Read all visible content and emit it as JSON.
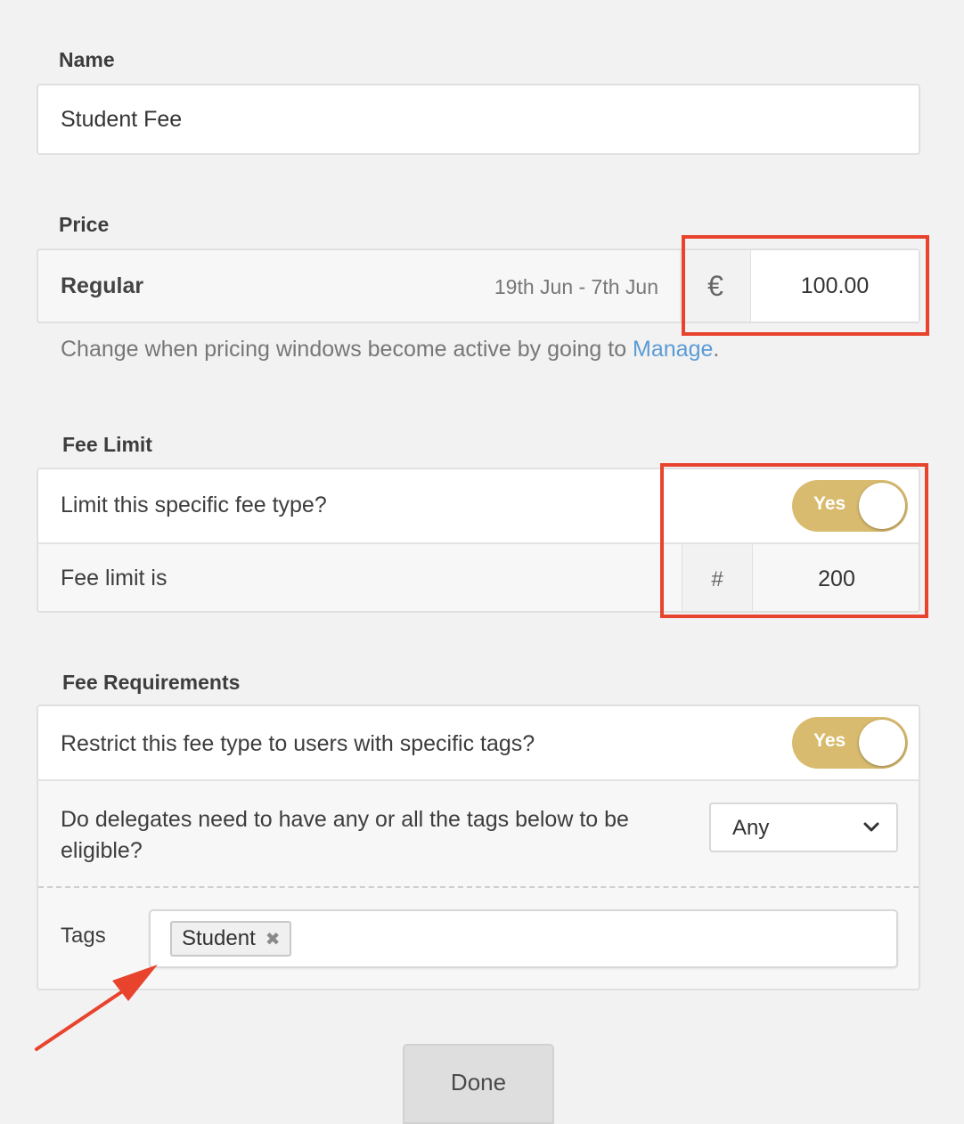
{
  "name_section": {
    "label": "Name",
    "value": "Student Fee"
  },
  "price_section": {
    "label": "Price",
    "window_name": "Regular",
    "window_dates": "19th Jun - 7th Jun",
    "currency_symbol": "€",
    "amount": "100.00",
    "help_text": "Change when pricing windows become active by going to ",
    "help_link": "Manage",
    "help_suffix": "."
  },
  "fee_limit_section": {
    "label": "Fee Limit",
    "question": "Limit this specific fee type?",
    "toggle_label": "Yes",
    "limit_label": "Fee limit is",
    "limit_prefix": "#",
    "limit_value": "200"
  },
  "requirements_section": {
    "label": "Fee Requirements",
    "question": "Restrict this fee type to users with specific tags?",
    "toggle_label": "Yes",
    "match_question": "Do delegates need to have any or all the tags below to be eligible?",
    "match_value": "Any",
    "tags_label": "Tags",
    "tags": [
      "Student"
    ]
  },
  "done_label": "Done",
  "colors": {
    "toggle_on": "#d8bb6e",
    "link": "#5b9bd5",
    "annotation": "#e8432d"
  }
}
